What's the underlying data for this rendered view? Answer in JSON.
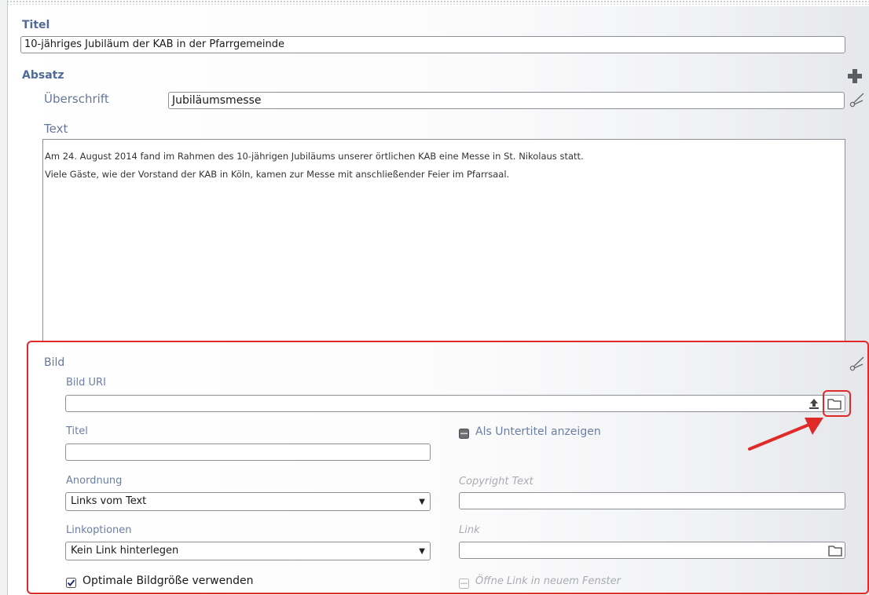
{
  "form": {
    "title_label": "Titel",
    "title_value": "10-jähriges Jubiläum der KAB in der Pfarrgemeinde",
    "absatz_label": "Absatz",
    "heading_label": "Überschrift",
    "heading_value": "Jubiläumsmesse",
    "text_label": "Text",
    "text_lines": [
      "Am 24. August 2014 fand im Rahmen des 10-jährigen Jubiläums unserer örtlichen KAB eine Messe in St. Nikolaus statt.",
      "Viele Gäste, wie der Vorstand der KAB in Köln, kamen zur Messe mit anschließender Feier im Pfarrsaal."
    ]
  },
  "image_section": {
    "label": "Bild",
    "uri_label": "Bild URI",
    "uri_value": "",
    "title_label": "Titel",
    "title_value": "",
    "subtitle_checkbox_label": "Als Untertitel anzeigen",
    "arrangement_label": "Anordnung",
    "arrangement_value": "Links vom Text",
    "copyright_label": "Copyright Text",
    "copyright_value": "",
    "link_options_label": "Linkoptionen",
    "link_options_value": "Kein Link hinterlegen",
    "link_label": "Link",
    "link_value": "",
    "optimal_size_label": "Optimale Bildgröße verwenden",
    "optimal_size_checked": true,
    "new_window_label": "Öffne Link in neuem Fenster",
    "new_window_checked": false
  },
  "icons": {
    "add": "plus-icon",
    "remove": "scissors-icon",
    "upload": "upload-icon",
    "browse": "folder-icon",
    "dropdown": "chevron-down-icon"
  },
  "colors": {
    "label_blue": "#4f6a98",
    "highlight_red": "#e02a2a"
  }
}
